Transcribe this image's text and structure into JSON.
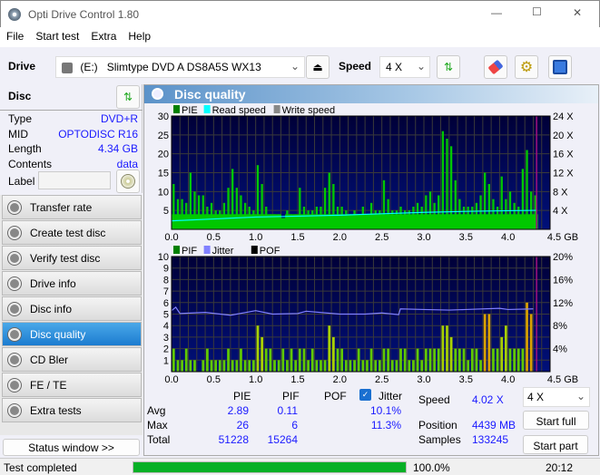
{
  "window": {
    "title": "Opti Drive Control 1.80",
    "minimize": "—",
    "maximize": "☐",
    "close": "✕"
  },
  "menu": [
    "File",
    "Start test",
    "Extra",
    "Help"
  ],
  "toolbar": {
    "drive_label": "Drive",
    "drive_letter": "(E:)",
    "drive_name": "Slimtype DVD A  DS8A5S WX13",
    "speed_label": "Speed",
    "speed_value": "4 X"
  },
  "disc": {
    "header": "Disc",
    "fields": [
      {
        "label": "Type",
        "value": "DVD+R"
      },
      {
        "label": "MID",
        "value": "OPTODISC R16"
      },
      {
        "label": "Length",
        "value": "4.34 GB"
      },
      {
        "label": "Contents",
        "value": "data"
      }
    ],
    "label_field": "Label",
    "label_value": ""
  },
  "nav": [
    {
      "label": "Transfer rate"
    },
    {
      "label": "Create test disc"
    },
    {
      "label": "Verify test disc"
    },
    {
      "label": "Drive info"
    },
    {
      "label": "Disc info"
    },
    {
      "label": "Disc quality",
      "active": true
    },
    {
      "label": "CD Bler"
    },
    {
      "label": "FE / TE"
    },
    {
      "label": "Extra tests"
    }
  ],
  "status_window": "Status window >>",
  "panel_title": "Disc quality",
  "chart_data": [
    {
      "type": "bar",
      "legend": [
        "PIE",
        "Read speed",
        "Write speed"
      ],
      "legend_colors": [
        "#008000",
        "#00ffff",
        "#888888"
      ],
      "xlim": [
        0,
        4.5
      ],
      "xticks": [
        "0.0",
        "0.5",
        "1.0",
        "1.5",
        "2.0",
        "2.5",
        "3.0",
        "3.5",
        "4.0",
        "4.5 GB"
      ],
      "ylim": [
        0,
        30
      ],
      "yticks": [
        "30",
        "25",
        "20",
        "15",
        "10",
        "5"
      ],
      "y2lim": [
        0,
        24
      ],
      "y2ticks": [
        "24 X",
        "20 X",
        "16 X",
        "12 X",
        "8 X",
        "4 X"
      ],
      "bin_width": 0.05,
      "pie": [
        12,
        8,
        8,
        7,
        15,
        10,
        9,
        9,
        6,
        7,
        5,
        5,
        7,
        11,
        16,
        11,
        9,
        7,
        6,
        5,
        17,
        12,
        6,
        4,
        4,
        4,
        3,
        5,
        4,
        4,
        11,
        6,
        5,
        5,
        6,
        6,
        11,
        15,
        12,
        6,
        6,
        5,
        4,
        5,
        4,
        6,
        4,
        7,
        5,
        5,
        13,
        8,
        5,
        5,
        6,
        5,
        5,
        6,
        7,
        6,
        9,
        10,
        7,
        9,
        26,
        24,
        22,
        13,
        8,
        6,
        6,
        6,
        7,
        9,
        15,
        12,
        8,
        6,
        14,
        8,
        10,
        7,
        6,
        16,
        21,
        10,
        9
      ],
      "read_speed": [
        [
          0,
          1.8
        ],
        [
          0.5,
          2.2
        ],
        [
          1.0,
          2.6
        ],
        [
          1.5,
          2.8
        ],
        [
          2.0,
          3.0
        ],
        [
          2.5,
          3.3
        ],
        [
          3.0,
          3.6
        ],
        [
          3.5,
          3.8
        ],
        [
          4.0,
          3.95
        ],
        [
          4.34,
          4.02
        ]
      ],
      "end_marker": 4.34
    },
    {
      "type": "bar",
      "legend": [
        "PIF",
        "Jitter",
        "POF"
      ],
      "legend_colors": [
        "#008000",
        "#8080ff",
        "#000000"
      ],
      "xlim": [
        0,
        4.5
      ],
      "xticks": [
        "0.0",
        "0.5",
        "1.0",
        "1.5",
        "2.0",
        "2.5",
        "3.0",
        "3.5",
        "4.0",
        "4.5 GB"
      ],
      "ylim": [
        0,
        10
      ],
      "yticks": [
        "10",
        "9",
        "8",
        "7",
        "6",
        "5",
        "4",
        "3",
        "2",
        "1"
      ],
      "y2lim": [
        0,
        20
      ],
      "y2ticks": [
        "20%",
        "16%",
        "12%",
        "8%",
        "4%"
      ],
      "bin_width": 0.05,
      "pif": [
        2,
        1,
        1,
        2,
        1,
        1,
        0,
        1,
        2,
        1,
        1,
        1,
        1,
        2,
        1,
        1,
        2,
        1,
        1,
        1,
        4,
        3,
        2,
        2,
        1,
        1,
        2,
        1,
        2,
        1,
        2,
        2,
        1,
        2,
        1,
        1,
        1,
        4,
        3,
        2,
        2,
        1,
        1,
        1,
        2,
        1,
        1,
        2,
        1,
        1,
        2,
        2,
        1,
        1,
        2,
        2,
        1,
        1,
        2,
        1,
        2,
        2,
        2,
        2,
        4,
        4,
        3,
        2,
        2,
        2,
        1,
        2,
        2,
        1,
        5,
        5,
        2,
        2,
        3,
        4,
        2,
        2,
        2,
        2,
        6,
        5,
        0
      ],
      "jitter": [
        [
          0,
          10.6
        ],
        [
          0.05,
          11.2
        ],
        [
          0.1,
          10.1
        ],
        [
          0.4,
          10.3
        ],
        [
          0.7,
          9.8
        ],
        [
          1.0,
          10.6
        ],
        [
          1.2,
          10.0
        ],
        [
          1.5,
          10.1
        ],
        [
          1.6,
          10.5
        ],
        [
          2.0,
          10.0
        ],
        [
          2.3,
          10.0
        ],
        [
          2.5,
          10.2
        ],
        [
          2.7,
          9.9
        ],
        [
          2.72,
          10.9
        ],
        [
          3.0,
          10.8
        ],
        [
          3.3,
          10.7
        ],
        [
          3.5,
          10.8
        ],
        [
          3.9,
          11.0
        ],
        [
          4.0,
          10.8
        ],
        [
          4.3,
          10.9
        ]
      ],
      "end_marker": 4.34
    }
  ],
  "stats": {
    "cols": [
      "PIE",
      "PIF",
      "POF",
      "Jitter"
    ],
    "jitter_checked": true,
    "rows": [
      {
        "label": "Avg",
        "pie": "2.89",
        "pif": "0.11",
        "pof": "",
        "jitter": "10.1%"
      },
      {
        "label": "Max",
        "pie": "26",
        "pif": "6",
        "pof": "",
        "jitter": "11.3%"
      },
      {
        "label": "Total",
        "pie": "51228",
        "pif": "15264",
        "pof": "",
        "jitter": ""
      }
    ],
    "speed_label": "Speed",
    "speed_value": "4.02 X",
    "position_label": "Position",
    "position_value": "4439 MB",
    "samples_label": "Samples",
    "samples_value": "133245",
    "speed_select": "4 X",
    "start_full": "Start full",
    "start_part": "Start part"
  },
  "status": {
    "text": "Test completed",
    "progress": 100.0,
    "progress_text": "100.0%",
    "time": "20:12"
  }
}
